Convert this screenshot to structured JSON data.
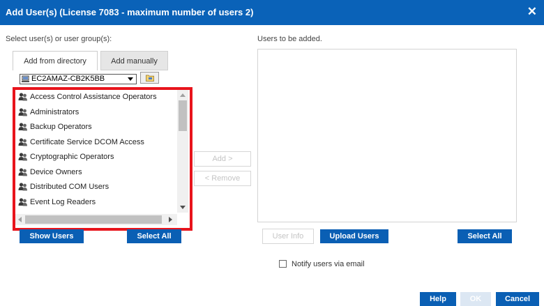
{
  "dialog": {
    "title": "Add User(s) (License 7083 - maximum number of users 2)",
    "close_icon": "close-icon"
  },
  "left": {
    "label": "Select user(s) or user group(s):",
    "tabs": [
      {
        "label": "Add from directory",
        "active": true
      },
      {
        "label": "Add manually",
        "active": false
      }
    ],
    "directory": {
      "selected": "EC2AMAZ-CB2K5BB"
    },
    "list_items": [
      "Access Control Assistance Operators",
      "Administrators",
      "Backup Operators",
      "Certificate Service DCOM Access",
      "Cryptographic Operators",
      "Device Owners",
      "Distributed COM Users",
      "Event Log Readers"
    ],
    "show_users_label": "Show Users",
    "select_all_label": "Select All"
  },
  "middle": {
    "add_label": "Add >",
    "remove_label": "< Remove"
  },
  "right": {
    "label": "Users to be added.",
    "user_info_label": "User Info",
    "upload_users_label": "Upload Users",
    "select_all_label": "Select All"
  },
  "notify": {
    "label": "Notify users via email",
    "checked": false
  },
  "footer": {
    "help_label": "Help",
    "ok_label": "OK",
    "cancel_label": "Cancel"
  },
  "colors": {
    "primary": "#0a5fb4",
    "title_bar": "#0a62b8",
    "highlight": "#e8141c"
  }
}
